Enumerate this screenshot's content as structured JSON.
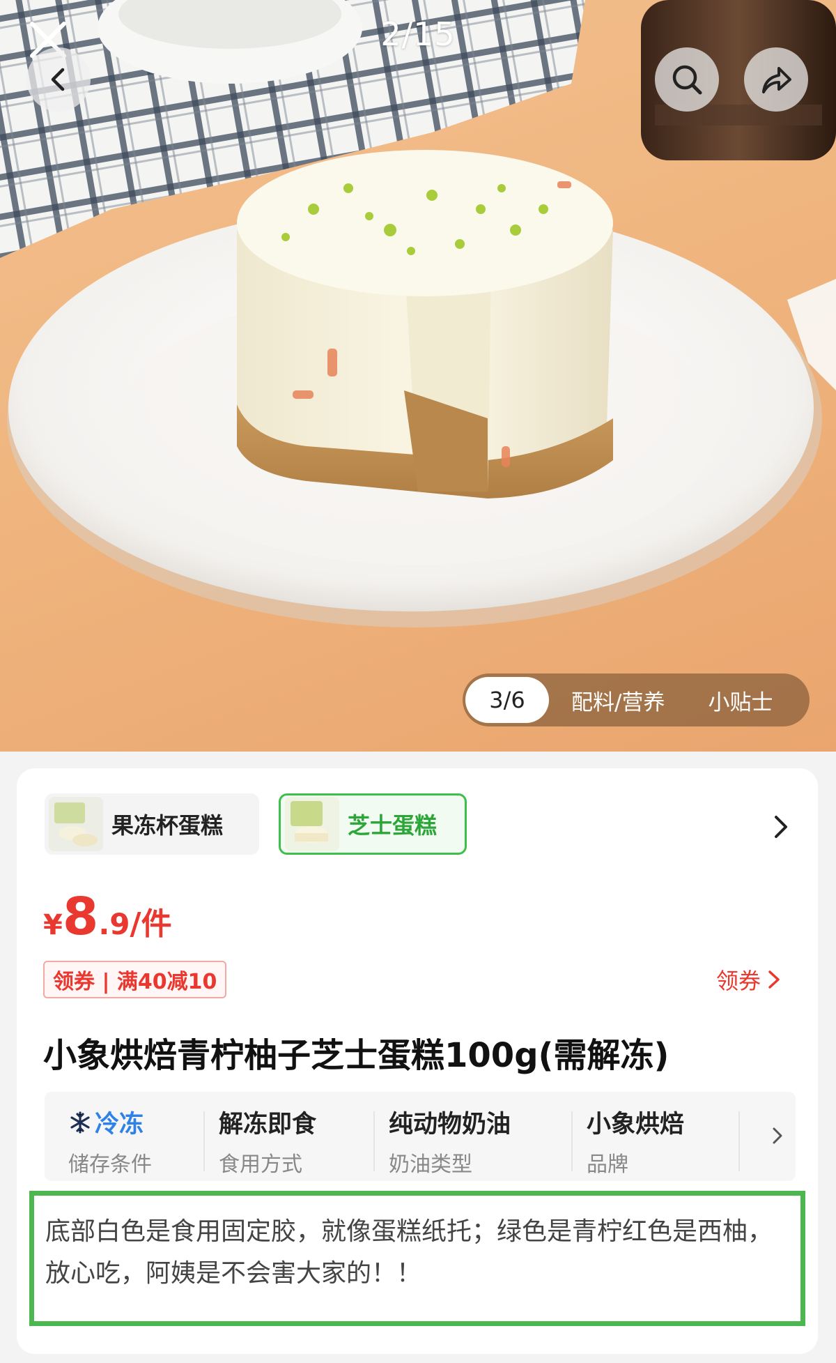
{
  "gallery": {
    "counter": "2/15",
    "tabs": {
      "active": "3/6",
      "ingredients": "配料/营养",
      "tips": "小贴士"
    }
  },
  "variants": [
    {
      "label": "果冻杯蛋糕",
      "selected": false
    },
    {
      "label": "芝士蛋糕",
      "selected": true
    }
  ],
  "price": {
    "currency": "¥",
    "integer": "8",
    "decimal": ".9",
    "unit": "/件"
  },
  "coupon": {
    "tag": "领券 | 满40减10",
    "link": "领券"
  },
  "product": {
    "title": "小象烘焙青柠柚子芝士蛋糕100g(需解冻)"
  },
  "specs": [
    {
      "value": "冷冻",
      "label": "储存条件"
    },
    {
      "value": "解冻即食",
      "label": "食用方式"
    },
    {
      "value": "纯动物奶油",
      "label": "奶油类型"
    },
    {
      "value": "小象烘焙",
      "label": "品牌"
    }
  ],
  "note": {
    "text": "底部白色是食用固定胶，就像蛋糕纸托；绿色是青柠红色是西柚，放心吃，阿姨是不会害大家的！！"
  },
  "colors": {
    "accent_red": "#e8382f",
    "accent_green": "#3fbe4c",
    "cold_blue": "#2f82e5"
  }
}
